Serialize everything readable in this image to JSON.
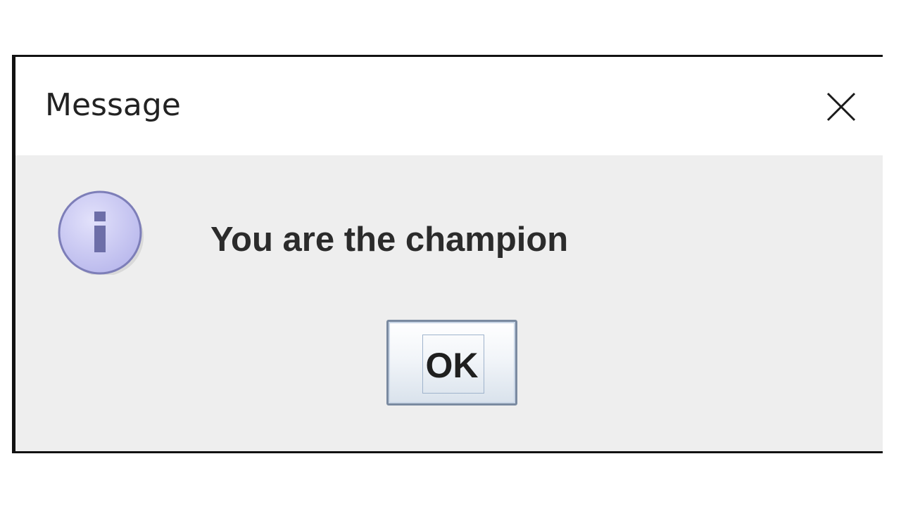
{
  "window": {
    "title": "Message",
    "close_icon": "close-icon"
  },
  "dialog": {
    "icon": "info-icon",
    "message": "You are the champion",
    "ok_label": "OK"
  },
  "colors": {
    "titlebar_bg": "#ffffff",
    "body_bg": "#eeeeee",
    "icon_fill": "#c9c8f2",
    "icon_glyph": "#6d6ea8",
    "button_border": "#7a8aa0"
  }
}
